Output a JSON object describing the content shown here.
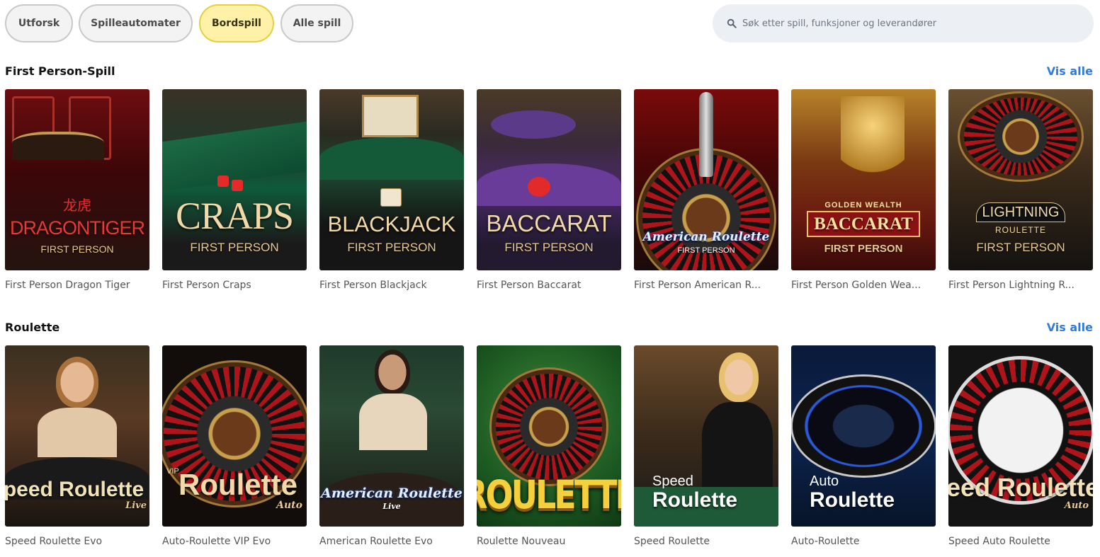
{
  "nav": {
    "tabs": [
      {
        "label": "Utforsk"
      },
      {
        "label": "Spilleautomater"
      },
      {
        "label": "Bordspill"
      },
      {
        "label": "Alle spill"
      }
    ],
    "search_placeholder": "Søk etter spill, funksjoner og leverandører"
  },
  "sections": [
    {
      "title": "First Person-Spill",
      "link": "Vis alle",
      "games": [
        {
          "name": "First Person Dragon Tiger",
          "logo_top": "龙虎",
          "logo_main": "DRAGONTIGER",
          "logo_sub": "FIRST PERSON"
        },
        {
          "name": "First Person Craps",
          "logo_main": "CRAPS",
          "logo_sub": "FIRST PERSON"
        },
        {
          "name": "First Person Blackjack",
          "logo_main": "BLACKJACK",
          "logo_sub": "FIRST PERSON"
        },
        {
          "name": "First Person Baccarat",
          "logo_main": "BACCARAT",
          "logo_sub": "FIRST PERSON"
        },
        {
          "name": "First Person American R...",
          "logo_main": "American Roulette",
          "logo_sub": "FIRST PERSON"
        },
        {
          "name": "First Person Golden Wea...",
          "logo_top": "GOLDEN WEALTH",
          "logo_main": "BACCARAT",
          "logo_sub": "FIRST PERSON"
        },
        {
          "name": "First Person Lightning R...",
          "logo_main": "LIGHTNING",
          "logo_mid": "ROULETTE",
          "logo_sub": "FIRST PERSON"
        }
      ]
    },
    {
      "title": "Roulette",
      "link": "Vis alle",
      "games": [
        {
          "name": "Speed Roulette Evo",
          "logo_main": "Speed Roulette",
          "logo_sub": "Live"
        },
        {
          "name": "Auto-Roulette VIP Evo",
          "logo_top": "VIP",
          "logo_main": "Roulette",
          "logo_sub": "Auto"
        },
        {
          "name": "American Roulette Evo",
          "logo_main": "American Roulette",
          "logo_sub": "Live"
        },
        {
          "name": "Roulette Nouveau",
          "logo_main": "ROULETTE"
        },
        {
          "name": "Speed Roulette",
          "logo_top": "Speed",
          "logo_main": "Roulette"
        },
        {
          "name": "Auto-Roulette",
          "logo_top": "Auto",
          "logo_main": "Roulette"
        },
        {
          "name": "Speed Auto Roulette",
          "logo_main": "Speed Roulette",
          "logo_sub": "Auto"
        }
      ]
    }
  ],
  "colors": {
    "active_tab_bg": "#fff2a8",
    "link": "#2f7be0",
    "search_bg": "#eceff3"
  }
}
